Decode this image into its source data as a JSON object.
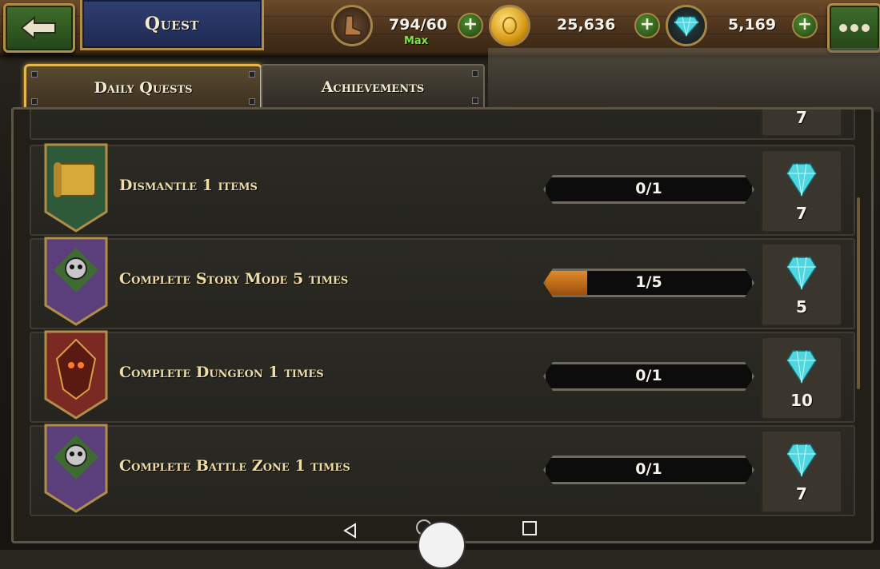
{
  "header": {
    "title": "Quest",
    "stamina": "794/60",
    "stamina_status": "Max",
    "gold": "25,636",
    "gems": "5,169"
  },
  "tabs": [
    {
      "label": "Daily Quests",
      "active": true
    },
    {
      "label": "Achievements",
      "active": false
    }
  ],
  "partial_top_reward": "7",
  "quests": [
    {
      "name": "Dismantle 1 items",
      "progress": "0/1",
      "current": 0,
      "total": 1,
      "reward": "7",
      "emblem": "scroll-icon",
      "emblem_color": "#2f5a3a"
    },
    {
      "name": "Complete Story Mode 5 times",
      "progress": "1/5",
      "current": 1,
      "total": 5,
      "reward": "5",
      "emblem": "skull-icon",
      "emblem_color": "#5a3f7a"
    },
    {
      "name": "Complete Dungeon 1 times",
      "progress": "0/1",
      "current": 0,
      "total": 1,
      "reward": "10",
      "emblem": "demon-icon",
      "emblem_color": "#7a2a22"
    },
    {
      "name": "Complete Battle Zone 1 times",
      "progress": "0/1",
      "current": 0,
      "total": 1,
      "reward": "7",
      "emblem": "skull-icon",
      "emblem_color": "#5a3f7a"
    }
  ],
  "colors": {
    "accent": "#e6b64a",
    "progress_fill": "#e08a2a",
    "gem": "#4fd6e0"
  }
}
